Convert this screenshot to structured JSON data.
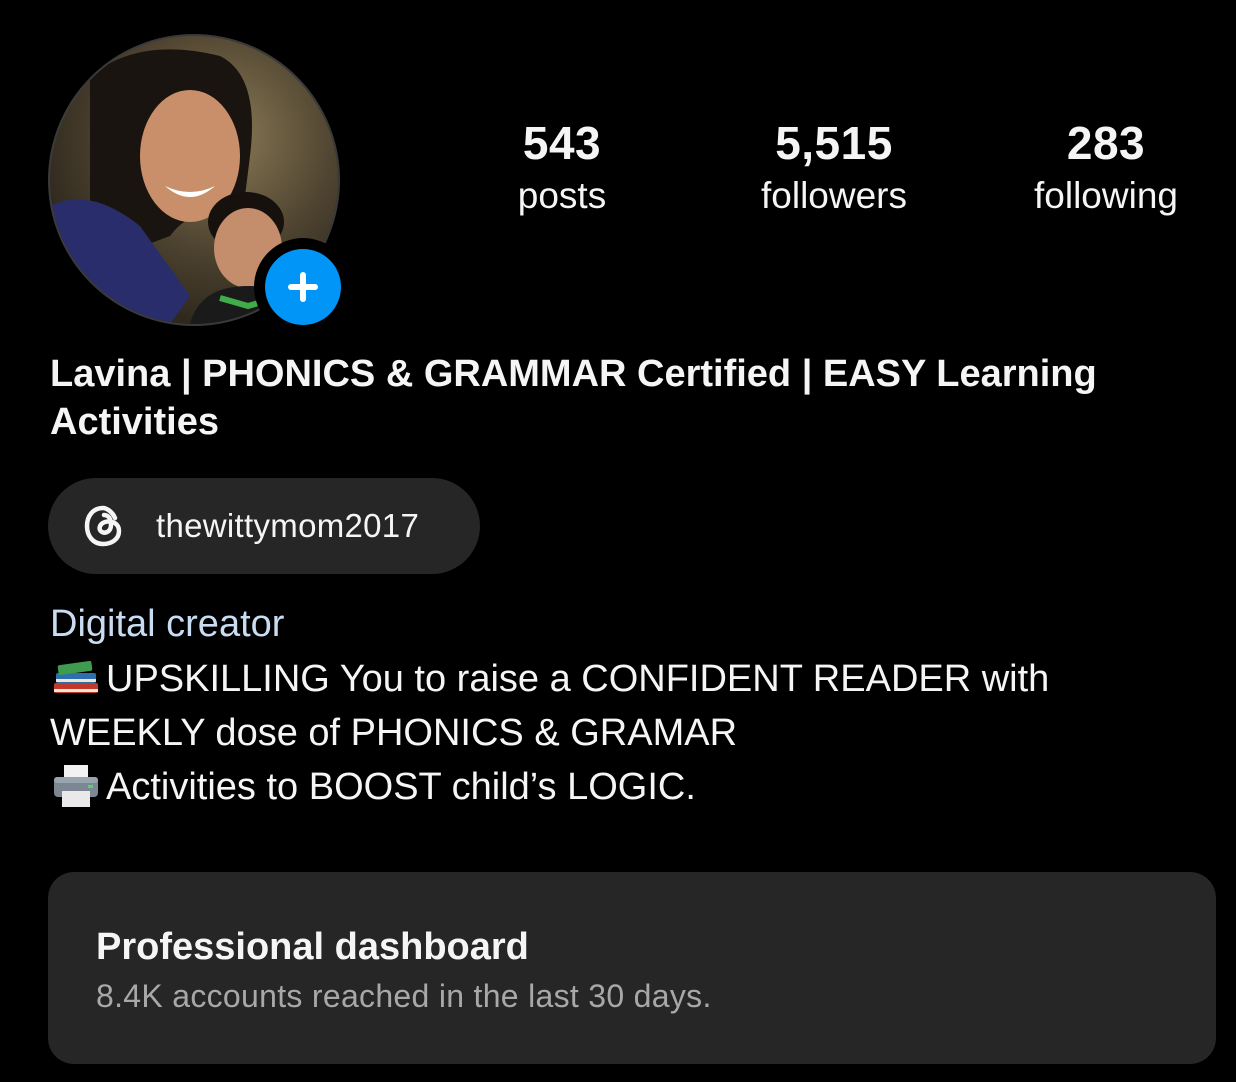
{
  "profile": {
    "avatar_icon": "profile-photo",
    "add_story_icon": "plus-icon",
    "accent_color": "#0095f6",
    "stats": [
      {
        "value": "543",
        "label": "posts"
      },
      {
        "value": "5,515",
        "label": "followers"
      },
      {
        "value": "283",
        "label": "following"
      }
    ],
    "display_name": "Lavina | PHONICS & GRAMMAR Certified | EASY Learning Activities",
    "threads": {
      "icon": "threads-icon",
      "handle": "thewittymom2017"
    },
    "category": "Digital creator",
    "category_color": "#c9dcf2",
    "bio": {
      "line1": "UPSKILLING You to raise a CONFIDENT READER with",
      "line2": "WEEKLY dose of PHONICS & GRAMAR",
      "line3": "Activities to BOOST child’s LOGIC.",
      "line1_emoji": "books-emoji",
      "line3_emoji": "printer-emoji"
    }
  },
  "dashboard": {
    "title": "Professional dashboard",
    "subtitle": "8.4K accounts reached in the last 30 days."
  }
}
